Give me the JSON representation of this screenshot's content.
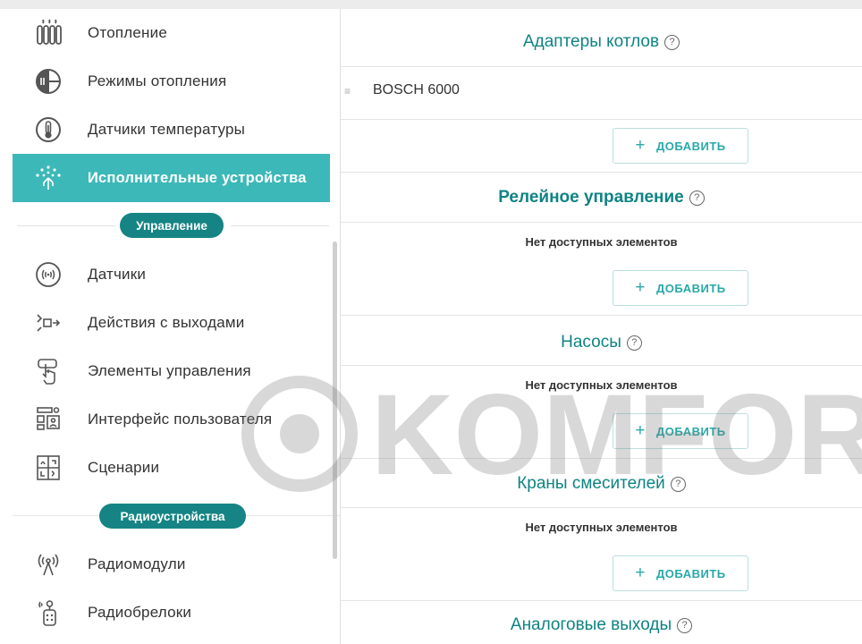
{
  "sidebar": {
    "items": [
      {
        "label": "Отопление",
        "icon": "radiator-icon"
      },
      {
        "label": "Режимы отопления",
        "icon": "heating-modes-icon"
      },
      {
        "label": "Датчики температуры",
        "icon": "thermometer-icon"
      },
      {
        "label": "Исполнительные устройства",
        "icon": "actuator-icon",
        "active": true
      },
      {
        "label": "Датчики",
        "icon": "sensor-icon"
      },
      {
        "label": "Действия с выходами",
        "icon": "outputs-icon"
      },
      {
        "label": "Элементы управления",
        "icon": "touch-control-icon"
      },
      {
        "label": "Интерфейс пользователя",
        "icon": "user-interface-icon"
      },
      {
        "label": "Сценарии",
        "icon": "scenarios-icon"
      },
      {
        "label": "Радиомодули",
        "icon": "radio-module-icon"
      },
      {
        "label": "Радиобрелоки",
        "icon": "key-fob-icon"
      }
    ],
    "sections": {
      "control": "Управление",
      "radio": "Радиоустройства"
    }
  },
  "main": {
    "add_label": "ДОБАВИТЬ",
    "empty_text": "Нет доступных элементов",
    "help_symbol": "?",
    "boiler_adapters": {
      "title": "Адаптеры котлов",
      "items": [
        "BOSCH 6000"
      ]
    },
    "relay_control": {
      "title": "Релейное управление"
    },
    "pumps": {
      "title": "Насосы"
    },
    "mixer_valves": {
      "title": "Краны смесителей"
    },
    "analog_outputs": {
      "title": "Аналоговые выходы"
    }
  },
  "watermark": "KOMFORT",
  "colors": {
    "accent": "#3db8b8",
    "dark_accent": "#168484",
    "heading": "#0f8383"
  }
}
